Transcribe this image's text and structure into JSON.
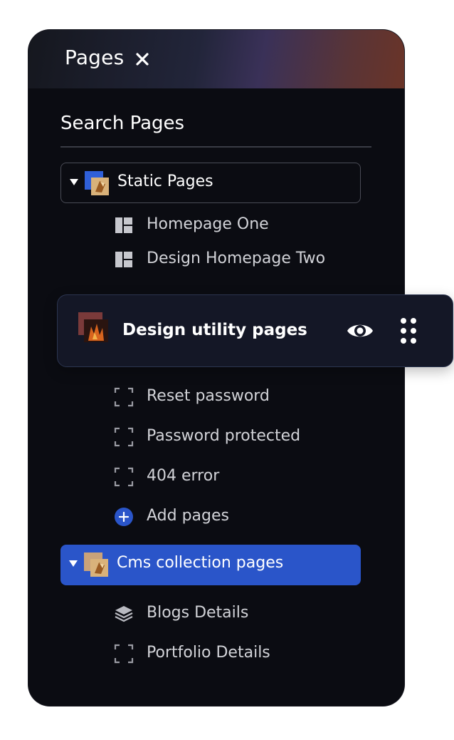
{
  "panel": {
    "title": "Pages",
    "close_icon": "close-icon"
  },
  "search": {
    "placeholder": "Search Pages",
    "value": ""
  },
  "groups": [
    {
      "label": "Static Pages",
      "expanded": true,
      "selected": false,
      "items": [
        {
          "label": "Homepage One",
          "icon": "layout-icon"
        },
        {
          "label": "Design Homepage Two",
          "icon": "layout-icon"
        }
      ]
    },
    {
      "label": "Design utility pages",
      "dragging": true,
      "actions": [
        "eye-icon",
        "drag-handle-icon"
      ],
      "items": [
        {
          "label": "Reset password",
          "icon": "dashed-frame-icon"
        },
        {
          "label": "Password protected",
          "icon": "dashed-frame-icon"
        },
        {
          "label": "404 error",
          "icon": "dashed-frame-icon"
        }
      ],
      "add_label": "Add pages"
    },
    {
      "label": "Cms collection pages",
      "expanded": true,
      "selected": true,
      "items": [
        {
          "label": "Blogs Details",
          "icon": "layers-icon"
        },
        {
          "label": "Portfolio Details",
          "icon": "dashed-frame-icon"
        }
      ]
    }
  ],
  "colors": {
    "panel_bg": "#0b0c12",
    "selected_group": "#2a55c9",
    "add_button": "#2a55c9",
    "card_bg": "#141726"
  }
}
